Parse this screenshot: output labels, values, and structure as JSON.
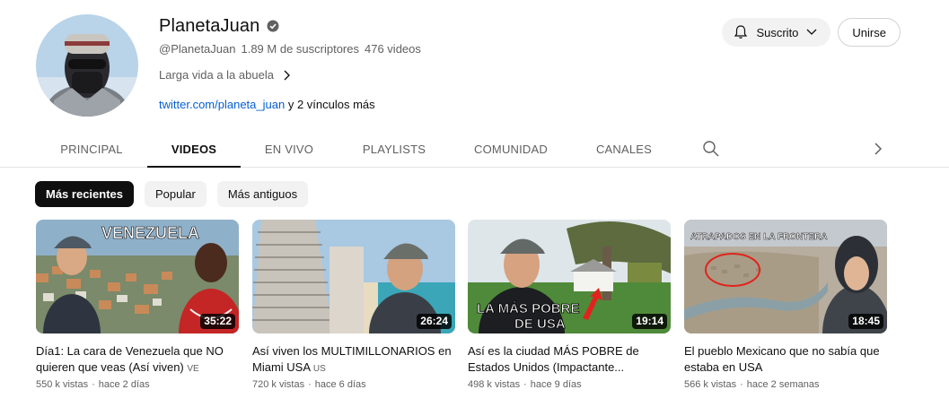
{
  "channel": {
    "name": "PlanetaJuan",
    "handle": "@PlanetaJuan",
    "subscribers": "1.89 M de suscriptores",
    "videos_count": "476 videos",
    "description": "Larga vida a la abuela",
    "link_text": "twitter.com/planeta_juan",
    "more_links": "y 2 vínculos más",
    "verified_icon": "verified-check-icon"
  },
  "buttons": {
    "subscribed_label": "Suscrito",
    "join_label": "Unirse"
  },
  "tabs": [
    {
      "label": "PRINCIPAL",
      "active": false
    },
    {
      "label": "VIDEOS",
      "active": true
    },
    {
      "label": "EN VIVO",
      "active": false
    },
    {
      "label": "PLAYLISTS",
      "active": false
    },
    {
      "label": "COMUNIDAD",
      "active": false
    },
    {
      "label": "CANALES",
      "active": false
    }
  ],
  "chips": [
    {
      "label": "Más recientes",
      "selected": true
    },
    {
      "label": "Popular",
      "selected": false
    },
    {
      "label": "Más antiguos",
      "selected": false
    }
  ],
  "videos": [
    {
      "thumb_text": "VENEZUELA",
      "duration": "35:22",
      "title": "Día1: La cara de Venezuela que NO quieren que veas (Así viven)",
      "badge": "VE",
      "views": "550 k vistas",
      "age": "hace 2 días"
    },
    {
      "thumb_text": "",
      "duration": "26:24",
      "title": "Así viven los MULTIMILLONARIOS en Miami USA",
      "badge": "US",
      "views": "720 k vistas",
      "age": "hace 6 días"
    },
    {
      "thumb_text": "LA MÁS POBRE DE USA",
      "thumb_text_line1": "LA MÁS POBRE",
      "thumb_text_line2": "DE USA",
      "duration": "19:14",
      "title": "Así es la ciudad MÁS POBRE de Estados Unidos (Impactante...",
      "badge": "",
      "views": "498 k vistas",
      "age": "hace 9 días"
    },
    {
      "thumb_text": "ATRAPADOS EN LA FRONTERA",
      "duration": "18:45",
      "title": "El pueblo Mexicano que no sabía que estaba en USA",
      "badge": "",
      "views": "566 k vistas",
      "age": "hace 2 semanas"
    }
  ],
  "meta_separator": "·",
  "colors": {
    "link": "#065fd4",
    "chip_selected_bg": "#0f0f0f",
    "chip_bg": "#f2f2f2",
    "secondary_text": "#606060",
    "thumb_highlight_red": "#e0241d"
  }
}
